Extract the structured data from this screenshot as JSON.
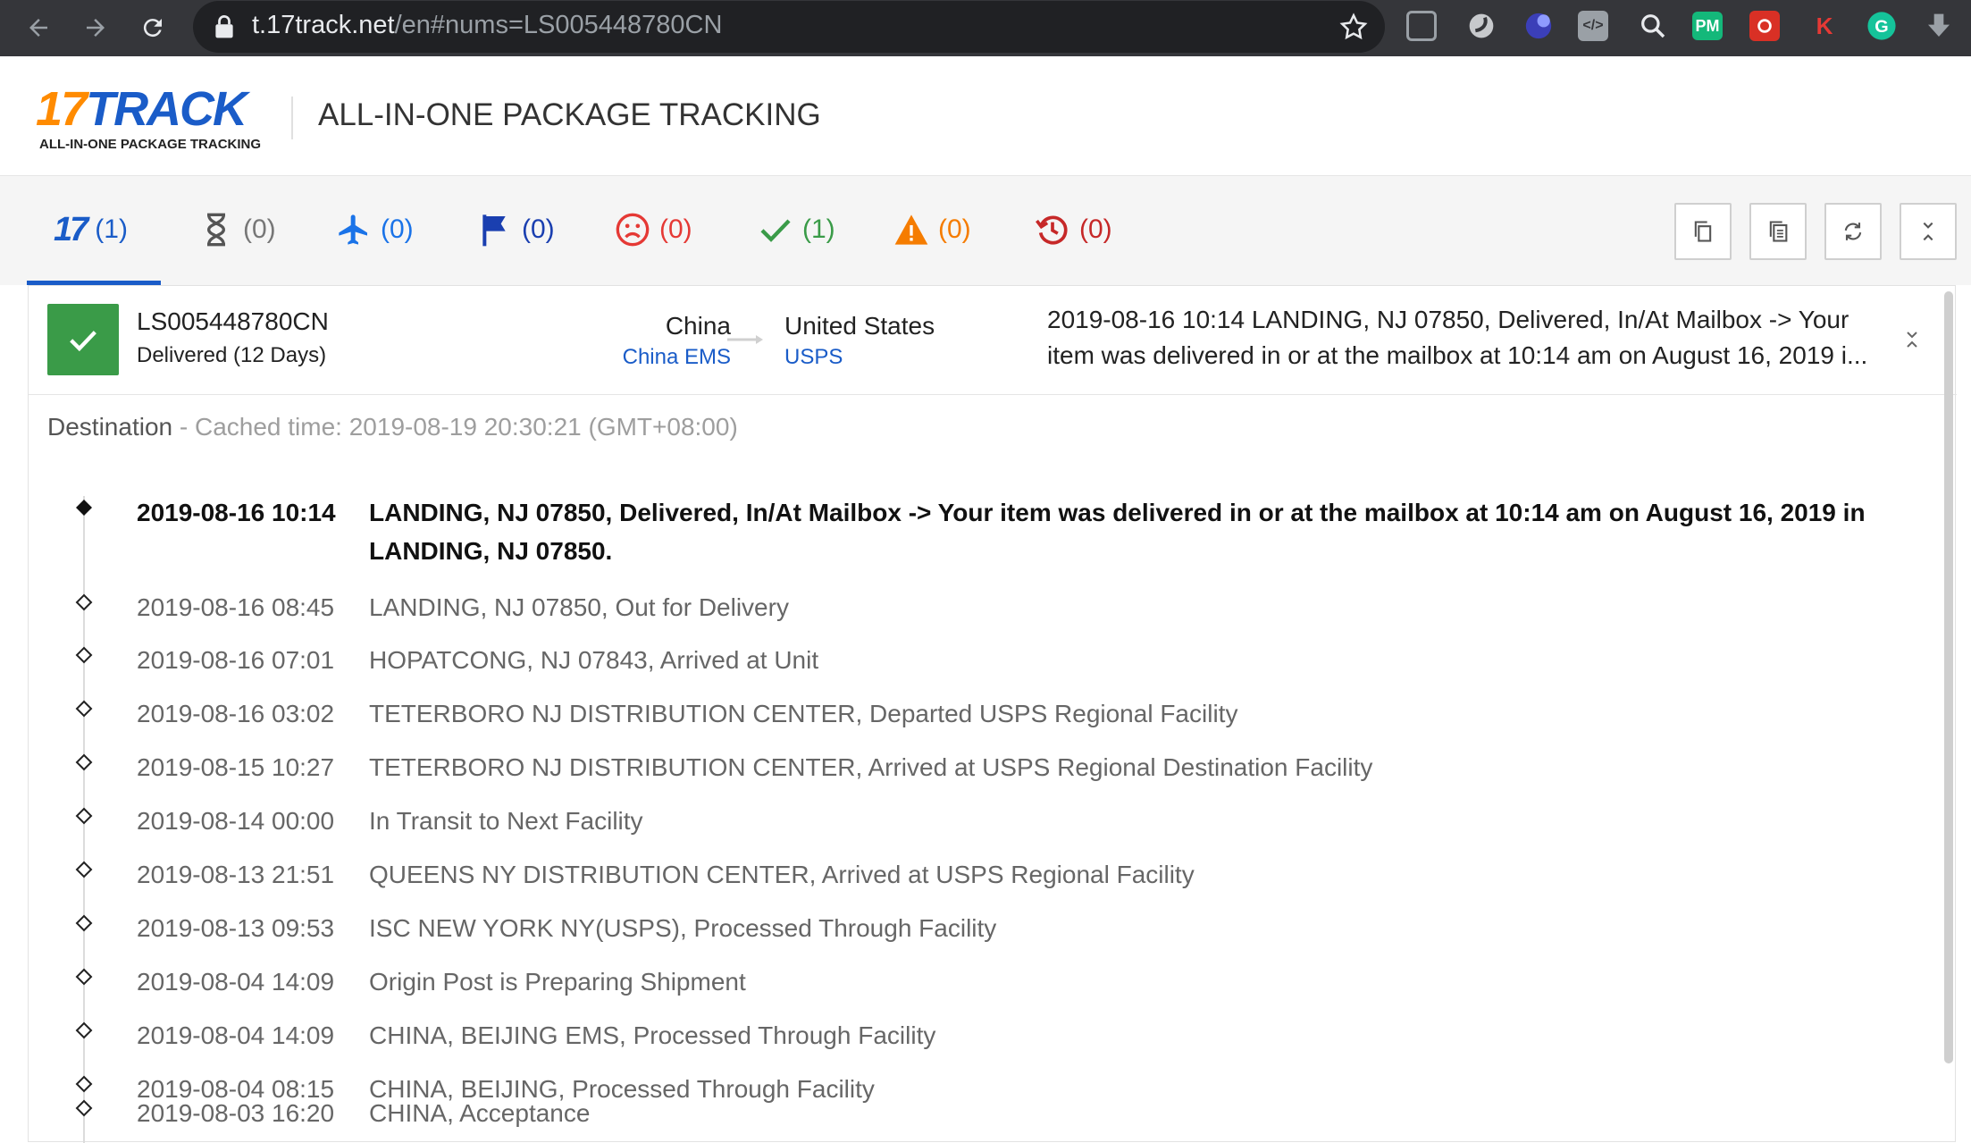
{
  "browser": {
    "url_host": "t.17track.net",
    "url_path": "/en#nums=LS005448780CN"
  },
  "site": {
    "logo_mark_1": "17",
    "logo_mark_2": "TRACK",
    "logo_tagline": "ALL-IN-ONE PACKAGE TRACKING",
    "title": "ALL-IN-ONE PACKAGE TRACKING"
  },
  "filters": [
    {
      "icon": "17-logo-icon",
      "count": "(1)",
      "color": "#1a5cc8"
    },
    {
      "icon": "hourglass-icon",
      "count": "(0)",
      "color": "#777777"
    },
    {
      "icon": "airplane-icon",
      "count": "(0)",
      "color": "#1a73e8"
    },
    {
      "icon": "flag-icon",
      "count": "(0)",
      "color": "#1a3fb0"
    },
    {
      "icon": "sad-face-icon",
      "count": "(0)",
      "color": "#e53935"
    },
    {
      "icon": "check-icon",
      "count": "(1)",
      "color": "#3a9b48"
    },
    {
      "icon": "warning-icon",
      "count": "(0)",
      "color": "#f57c00"
    },
    {
      "icon": "history-icon",
      "count": "(0)",
      "color": "#c62828"
    }
  ],
  "shipment": {
    "tracking_number": "LS005448780CN",
    "status": "Delivered (12 Days)",
    "origin_country": "China",
    "origin_carrier": "China EMS",
    "dest_country": "United States",
    "dest_carrier": "USPS",
    "latest": "2019-08-16 10:14  LANDING, NJ 07850, Delivered, In/At Mailbox -> Your item was delivered in or at the mailbox at 10:14 am on August 16, 2019 i..."
  },
  "destination": {
    "label": "Destination",
    "cached": " - Cached time: 2019-08-19 20:30:21 (GMT+08:00)"
  },
  "events": [
    {
      "time": "2019-08-16 10:14",
      "desc": "LANDING, NJ 07850, Delivered, In/At Mailbox -> Your item was delivered in or at the mailbox at 10:14 am on August 16, 2019 in LANDING, NJ 07850."
    },
    {
      "time": "2019-08-16 08:45",
      "desc": "LANDING, NJ 07850, Out for Delivery"
    },
    {
      "time": "2019-08-16 07:01",
      "desc": "HOPATCONG, NJ 07843, Arrived at Unit"
    },
    {
      "time": "2019-08-16 03:02",
      "desc": "TETERBORO NJ DISTRIBUTION CENTER, Departed USPS Regional Facility"
    },
    {
      "time": "2019-08-15 10:27",
      "desc": "TETERBORO NJ DISTRIBUTION CENTER, Arrived at USPS Regional Destination Facility"
    },
    {
      "time": "2019-08-14 00:00",
      "desc": "In Transit to Next Facility"
    },
    {
      "time": "2019-08-13 21:51",
      "desc": "QUEENS NY DISTRIBUTION CENTER, Arrived at USPS Regional Facility"
    },
    {
      "time": "2019-08-13 09:53",
      "desc": "ISC NEW YORK NY(USPS), Processed Through Facility"
    },
    {
      "time": "2019-08-04 14:09",
      "desc": "Origin Post is Preparing Shipment"
    },
    {
      "time": "2019-08-04 14:09",
      "desc": "CHINA, BEIJING EMS, Processed Through Facility"
    },
    {
      "time": "2019-08-04 08:15",
      "desc": "CHINA, BEIJING, Processed Through Facility"
    },
    {
      "time": "2019-08-03 16:20",
      "desc": "CHINA, Acceptance"
    }
  ]
}
